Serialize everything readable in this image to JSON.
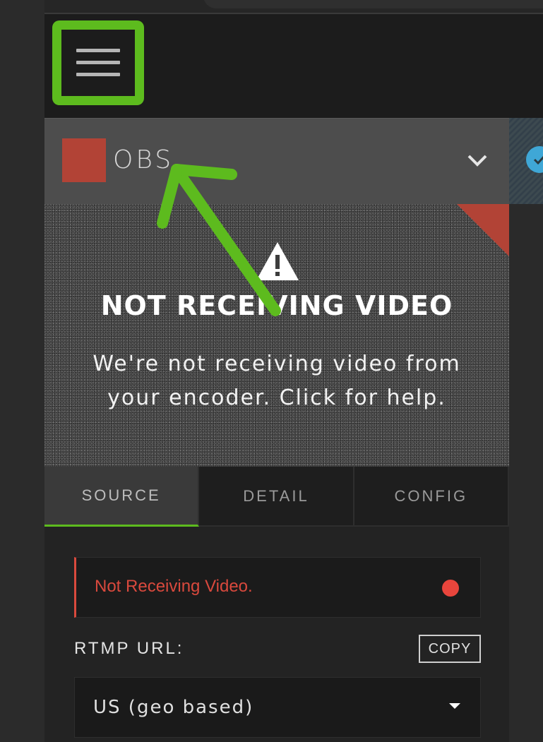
{
  "menu": {
    "icon": "hamburger-menu-icon"
  },
  "source": {
    "name": "OBS",
    "swatch_color": "#b24336",
    "expand_icon": "chevron-down-icon",
    "status_badge_icon": "check-circle-icon"
  },
  "video": {
    "warning_icon": "warning-triangle-icon",
    "title": "NOT RECEIVING VIDEO",
    "description": "We're not receiving video from your encoder. Click for help."
  },
  "tabs": [
    {
      "label": "SOURCE",
      "active": true
    },
    {
      "label": "DETAIL",
      "active": false
    },
    {
      "label": "CONFIG",
      "active": false
    }
  ],
  "status": {
    "text": "Not Receiving Video.",
    "color": "#d9493d"
  },
  "rtmp": {
    "label": "RTMP URL:",
    "copy_label": "COPY",
    "selected_value": "US (geo based)"
  },
  "annotation": {
    "highlight_color": "#5dbb1e"
  }
}
